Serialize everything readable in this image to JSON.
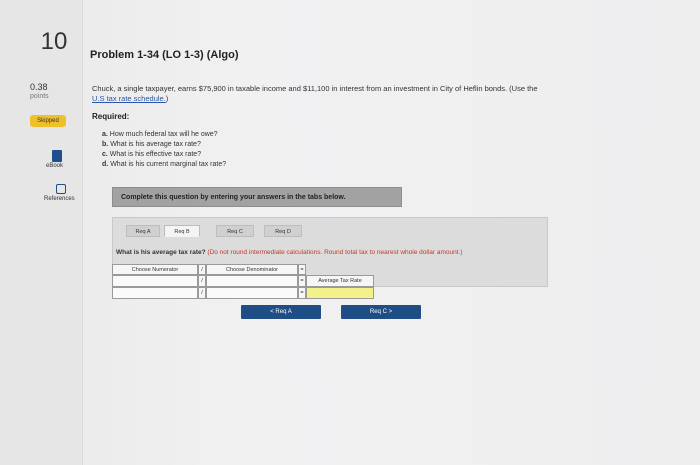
{
  "left_rail": {
    "question_number": "10",
    "points": "0.38",
    "points_label": "points",
    "status": "Skipped",
    "ebook_label": "eBook",
    "references_label": "References"
  },
  "problem": {
    "title": "Problem 1-34 (LO 1-3) (Algo)",
    "description_prefix": "Chuck, a single taxpayer, earns $75,900 in taxable income and $11,100 in interest from an investment in City of Heflin bonds. (Use the",
    "description_link": "U.S tax rate schedule.",
    "description_suffix": ")",
    "required_heading": "Required:",
    "requirements": [
      {
        "letter": "a.",
        "text": "How much federal tax will he owe?"
      },
      {
        "letter": "b.",
        "text": "What is his average tax rate?"
      },
      {
        "letter": "c.",
        "text": "What is his effective tax rate?"
      },
      {
        "letter": "d.",
        "text": "What is his current marginal tax rate?"
      }
    ]
  },
  "banner": {
    "text": "Complete this question by entering your answers in the tabs below."
  },
  "tabs": [
    {
      "label": "Req A",
      "active": false
    },
    {
      "label": "Req B",
      "active": true
    },
    {
      "label": "Req C",
      "active": false
    },
    {
      "label": "Req D",
      "active": false
    }
  ],
  "instruction": {
    "question": "What is his average tax rate?",
    "note": "(Do not round intermediate calculations. Round total tax to nearest whole dollar amount.)"
  },
  "calc": {
    "numerator_header": "Choose Numerator",
    "divide_symbol": "/",
    "denominator_header": "Choose Denominator",
    "equals_symbol": "=",
    "result_label": "Average Tax Rate",
    "numerator_value": "",
    "denominator_value": "",
    "result_value": ""
  },
  "nav": {
    "prev_label": "< Req A",
    "next_label": "Req C >"
  }
}
